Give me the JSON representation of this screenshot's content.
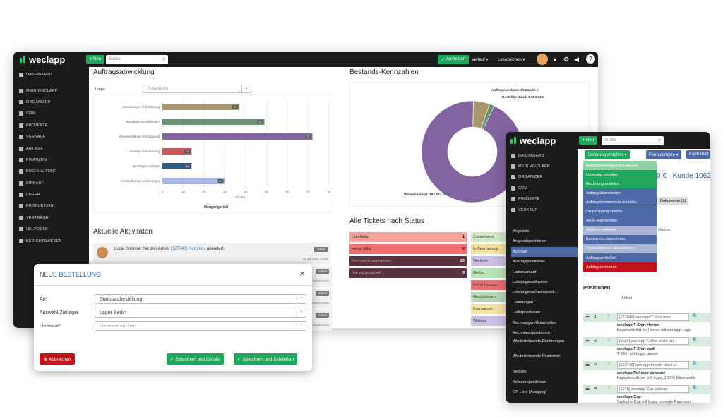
{
  "w1": {
    "logo": "weclapp",
    "neu": "+ Neu",
    "search": "Suche",
    "anmelden": "Anmelden",
    "verlauf": "Verlauf",
    "lesezeichen": "Lesezeichen",
    "nav": [
      "DASHBOARD",
      "MEIN WECLAPP",
      "ORGANIZER",
      "CRM",
      "PROJEKTE",
      "VERKAUF",
      "ARTIKEL",
      "FINANZEN",
      "BUCHHALTUNG",
      "EINKAUF",
      "LAGER",
      "PRODUKTION",
      "VERTRÄGE",
      "HELPDESK",
      "BERICHTSWESEN"
    ]
  },
  "auftrag": {
    "title": "Auftragsabwicklung",
    "lager_label": "Lager",
    "lager_ph": "Auswählen",
    "axis_label": "Anzahl",
    "footer": "Mengengerüst"
  },
  "chart_data": [
    {
      "type": "bar",
      "title": "Auftragsabwicklung",
      "xlabel": "Anzahl",
      "categories": [
        "Bestellungen in Erfassung",
        "Bestätigte Bestellungen",
        "Wareneingänge in Erfassung",
        "Aufträge in Erfassung",
        "Bestätigte Aufträge",
        "Versandbereite Lieferungen"
      ],
      "values": [
        37,
        49,
        72,
        14,
        14,
        30
      ],
      "colors": [
        "#a8976c",
        "#6e8f74",
        "#8264a0",
        "#c65a5a",
        "#2f5a85",
        "#a8b8e0"
      ],
      "xlim": [
        0,
        80
      ],
      "ticks": [
        0,
        10,
        20,
        30,
        40,
        50,
        60,
        70,
        80
      ]
    },
    {
      "type": "pie",
      "title": "Bestands-Kennzahlen",
      "labels": [
        "Auftragsbestand",
        "Bestellbestand",
        "Warenbestand"
      ],
      "values": [
        10244.3,
        3003.33,
        182073.16
      ],
      "display": [
        "Auftragsbestand: 10.244,30 €",
        "Bestellbestand: 3.003,33 €",
        "Warenbestand: 182.073,16 €"
      ],
      "colors": [
        "#a8976c",
        "#6e8f74",
        "#8264a0"
      ]
    }
  ],
  "bestand": {
    "title": "Bestands-Kennzahlen"
  },
  "akt": {
    "title": "Aktuelle Aktivitäten",
    "user": "Lucie Sommer",
    "text1": " hat den Artikel ",
    "link": "[127745] Hummus",
    "text2": " geändert.",
    "badge": "Artikel",
    "time": "18.12.2023 14:35",
    "times": [
      "18.12.2023 14:30",
      "18.12.2023 14:29",
      "18.12.2023 14:29"
    ]
  },
  "tickets": {
    "title": "Alle Tickets nach Status",
    "left": [
      {
        "l": "Überfällig",
        "v": "1",
        "c": "#f4a29a"
      },
      {
        "l": "Heute fällig",
        "v": "0",
        "c": "#ef6d6d"
      },
      {
        "l": "Noch nicht zugewiesen",
        "v": "23",
        "c": "#5a3141"
      },
      {
        "l": "Not yet assigned",
        "v": "3",
        "c": "#5a3141"
      }
    ],
    "right": [
      {
        "l": "Zugewiesen",
        "c": "#cfe9c6"
      },
      {
        "l": "In Bearbeitung",
        "c": "#f3e1a0"
      },
      {
        "l": "Wartend",
        "c": "#cbbfe2"
      },
      {
        "l": "Gelöst",
        "c": "#b8e6b8"
      },
      {
        "l": "Keine Lösung",
        "c": "#ef6d6d"
      },
      {
        "l": "Geschlossen",
        "c": "#b8d8b8"
      },
      {
        "l": "In progress",
        "c": "#f3e1a0"
      },
      {
        "l": "Waiting",
        "c": "#cbbfe2"
      }
    ]
  },
  "dlg": {
    "title": "NEUE BESTELLUNG",
    "art_l": "Art*",
    "art_v": "Standardbestellung",
    "lager_l": "Auswahl Ziellager",
    "lager_v": "Lager Berlin",
    "lief_l": "Lieferant*",
    "lief_ph": "Lieferant suchen",
    "abbrechen": "Abbrechen",
    "save1": "Speichern und Details",
    "save2": "Speichern und Schließen"
  },
  "w2": {
    "logo": "weclapp",
    "neu": "+ Neu",
    "search": "Suche",
    "nav": [
      "DASHBOARD",
      "MEIN WECLAPP",
      "ORGANIZER",
      "CRM",
      "PROJEKTE",
      "VERKAUF"
    ],
    "sub": [
      "Angebote",
      "Angebotspositionen",
      "Aufträge",
      "Auftragspositionen",
      "Ladenverkauf",
      "Leistungsnachweise",
      "Leistungsnachweispositi...",
      "Lieferungen",
      "Lieferpositionen",
      "Rechnungen/Gutschriften",
      "Rechnungspositionen",
      "Wiederkehrende Rechnungen",
      "Wiederkehrende Positionen",
      "Retoure",
      "Retourenpositionen",
      "OP-Liste (Ausgang)"
    ],
    "btn_lief": "Lieferung erstellen",
    "btn_form": "Formulartexte",
    "btn_kopf": "Kopfrabatt",
    "menu": [
      {
        "l": "Auftragsbestätigung erzeugen",
        "c": "#8fd1a3"
      },
      {
        "l": "Lieferung erstellen",
        "c": "#1fa85b"
      },
      {
        "l": "Rechnung erstellen",
        "c": "#1fa85b"
      },
      {
        "l": "Auftrag überarbeiten",
        "c": "#4d6aa8"
      },
      {
        "l": "Auftragskommission erstellen",
        "c": "#4d6aa8"
      },
      {
        "l": "Dropshipping starten",
        "c": "#4d6aa8"
      },
      {
        "l": "Als E-Mail senden",
        "c": "#4d6aa8"
      },
      {
        "l": "Retoure erstellen",
        "c": "#a9b5d4"
      },
      {
        "l": "Kosten neu berechnen",
        "c": "#4d6aa8"
      },
      {
        "l": "Verkaufspreise aktualisieren",
        "c": "#a9b5d4"
      },
      {
        "l": "Auftrag schließen",
        "c": "#4d6aa8"
      },
      {
        "l": "Auftrag stornieren",
        "c": "#c0141c"
      }
    ],
    "kunde": "0 € · Kunde 1062",
    "tab_dok": "Dokumente (1)",
    "pos_title": "Positionen",
    "artikel": "Artikel",
    "ellenas": "ellenas",
    "pos": [
      {
        "n": "1",
        "code": "[123648] weclapp T-Shirt men",
        "name": "weclapp T-Shirt Herren",
        "desc": "Baumwollshirt für Herren mit weclapp Logo"
      },
      {
        "n": "2",
        "code": "[abcd] weclapp T-Shirt white vin",
        "name": "weclapp T-Shirt weiß",
        "desc": "T-Shirt mit Logo, unisex"
      },
      {
        "n": "3",
        "code": "[123745] weclapp hoodie black vi",
        "name": "weclapp Pullover schwarz",
        "desc": "Kapuzenpullover mit Logo, 100 % Baumwolle"
      },
      {
        "n": "4",
        "code": "[1245] weclapp Cap Vintage",
        "name": "weclapp Cap",
        "desc": "Stylische Cap mit Logo, normale Passform"
      }
    ]
  }
}
